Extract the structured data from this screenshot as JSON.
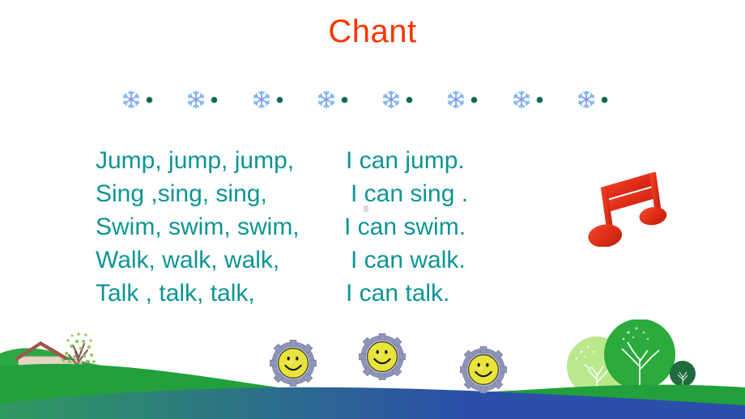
{
  "slide": {
    "title": "Chant",
    "title_color": "#FF3300",
    "background_color": "#FFFFFF",
    "text_color": "#0E9594"
  },
  "decoration": {
    "snowflake_color": "#7FB6F0",
    "dot_color": "#0E6655",
    "snowflake_count": 8,
    "dot_count": 8
  },
  "lyrics": {
    "lines": [
      {
        "left": "Jump, jump, jump,",
        "right": "I can jump."
      },
      {
        "left": "Sing ,sing, sing,",
        "right": "I can sing ."
      },
      {
        "left": "Swim, swim, swim,",
        "right": "I can swim."
      },
      {
        "left": "Walk, walk, walk,",
        "right": "I can walk."
      },
      {
        "left": "Talk , talk, talk,",
        "right": "I can talk."
      }
    ]
  },
  "clipart": {
    "music_note": "music-note-icon",
    "music_note_color": "#E0301E",
    "smiley_gears": [
      "smiley-gear-icon",
      "smiley-gear-icon",
      "smiley-gear-icon"
    ],
    "smiley_face_color": "#E8E43C",
    "gear_color": "#9095B8"
  },
  "scenery": {
    "house": "house-icon",
    "house_roof_color": "#A0564B",
    "house_wall_color": "#E8D8C8",
    "house_door_color": "#9C4A3C",
    "tree": "tree-icon",
    "hill_color": "#22A03C",
    "bush_light_color": "#BBE88C",
    "bush_mid_color": "#2CAA3E",
    "bush_dark_color": "#1E6B3C",
    "water_band_gradient": [
      "#2E9A5E",
      "#2B4FA8"
    ]
  }
}
